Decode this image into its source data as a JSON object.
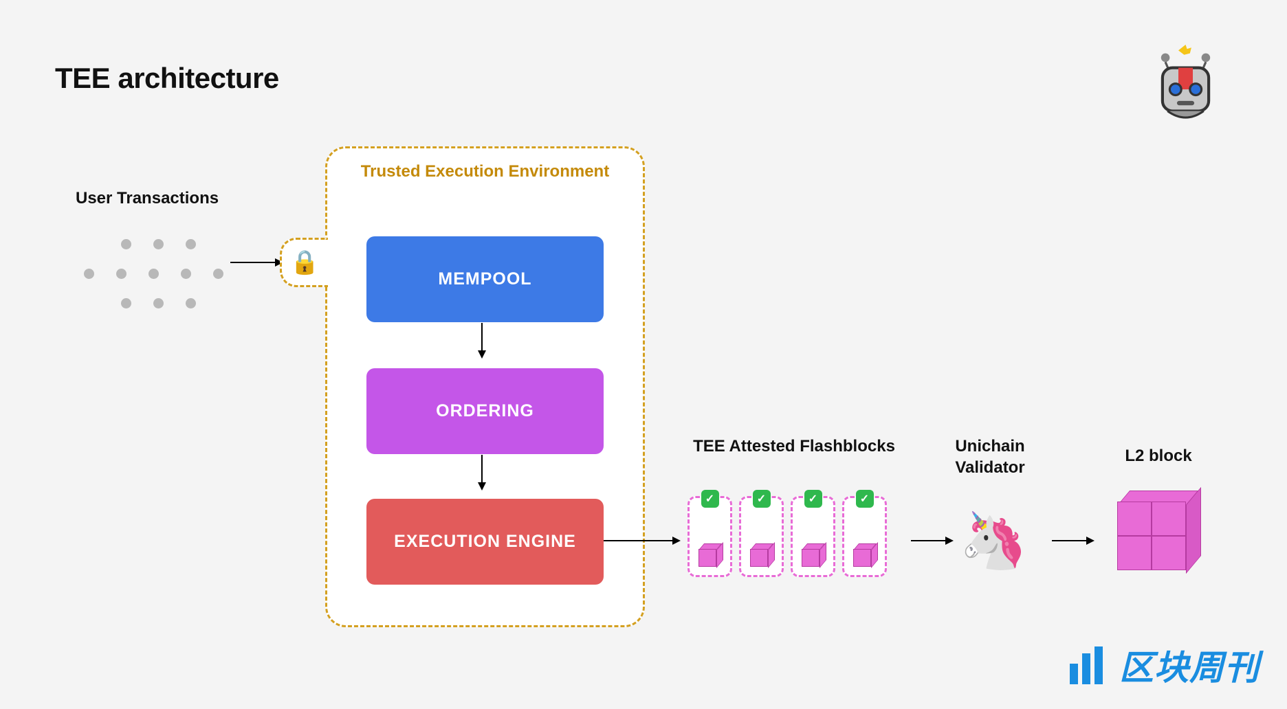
{
  "title": "TEE architecture",
  "user_tx_label": "User Transactions",
  "tee": {
    "title": "Trusted Execution Environment",
    "stages": {
      "mempool": "MEMPOOL",
      "ordering": "ORDERING",
      "exec": "EXECUTION ENGINE"
    }
  },
  "flashblocks_label": "TEE Attested Flashblocks",
  "validator_label": "Unichain Validator",
  "l2_label": "L2 block",
  "watermark": "区块周刊",
  "icons": {
    "lock": "🔒",
    "unicorn": "🦄",
    "check": "✓"
  },
  "colors": {
    "tee_border": "#d4a020",
    "mempool": "#3d7ae6",
    "ordering": "#c456e8",
    "exec": "#e25b5b",
    "flashblock_border": "#e86bd6",
    "check_bg": "#2fb84d",
    "watermark": "#1a8de0"
  }
}
